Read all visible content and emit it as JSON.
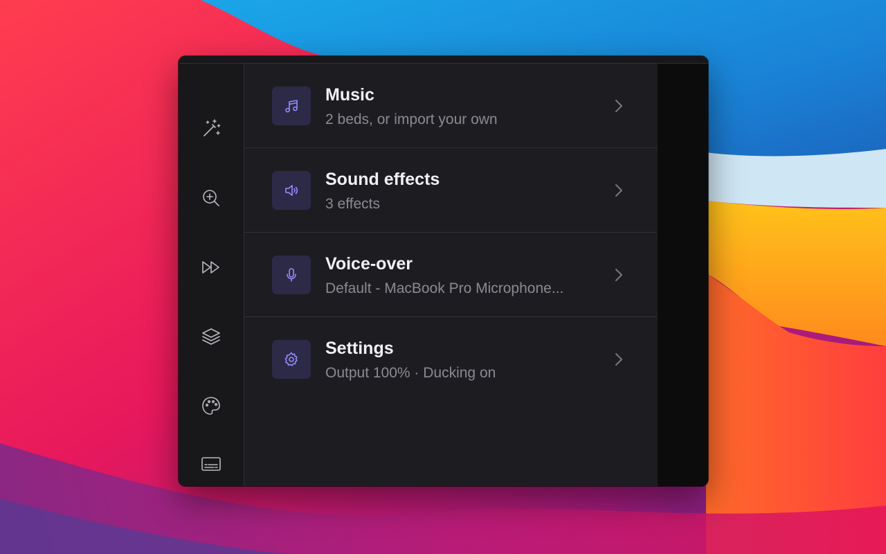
{
  "sidebar": {
    "items": [
      {
        "icon": "magic-wand-icon"
      },
      {
        "icon": "zoom-in-icon"
      },
      {
        "icon": "fast-forward-icon"
      },
      {
        "icon": "layers-icon"
      },
      {
        "icon": "palette-icon"
      },
      {
        "icon": "subtitles-icon"
      }
    ]
  },
  "menu": {
    "items": [
      {
        "icon": "music-note-icon",
        "title": "Music",
        "subtitle": "2 beds, or import your own"
      },
      {
        "icon": "speaker-icon",
        "title": "Sound effects",
        "subtitle": "3 effects"
      },
      {
        "icon": "microphone-icon",
        "title": "Voice-over",
        "subtitle": "Default - MacBook Pro Microphone..."
      },
      {
        "icon": "gear-icon",
        "title": "Settings",
        "subtitle": "Output 100% · Ducking on"
      }
    ]
  },
  "colors": {
    "accent": "#9a8cff",
    "icon_tile": "#2c2a47",
    "panel": "#1d1d21",
    "rail": "#18181b"
  }
}
